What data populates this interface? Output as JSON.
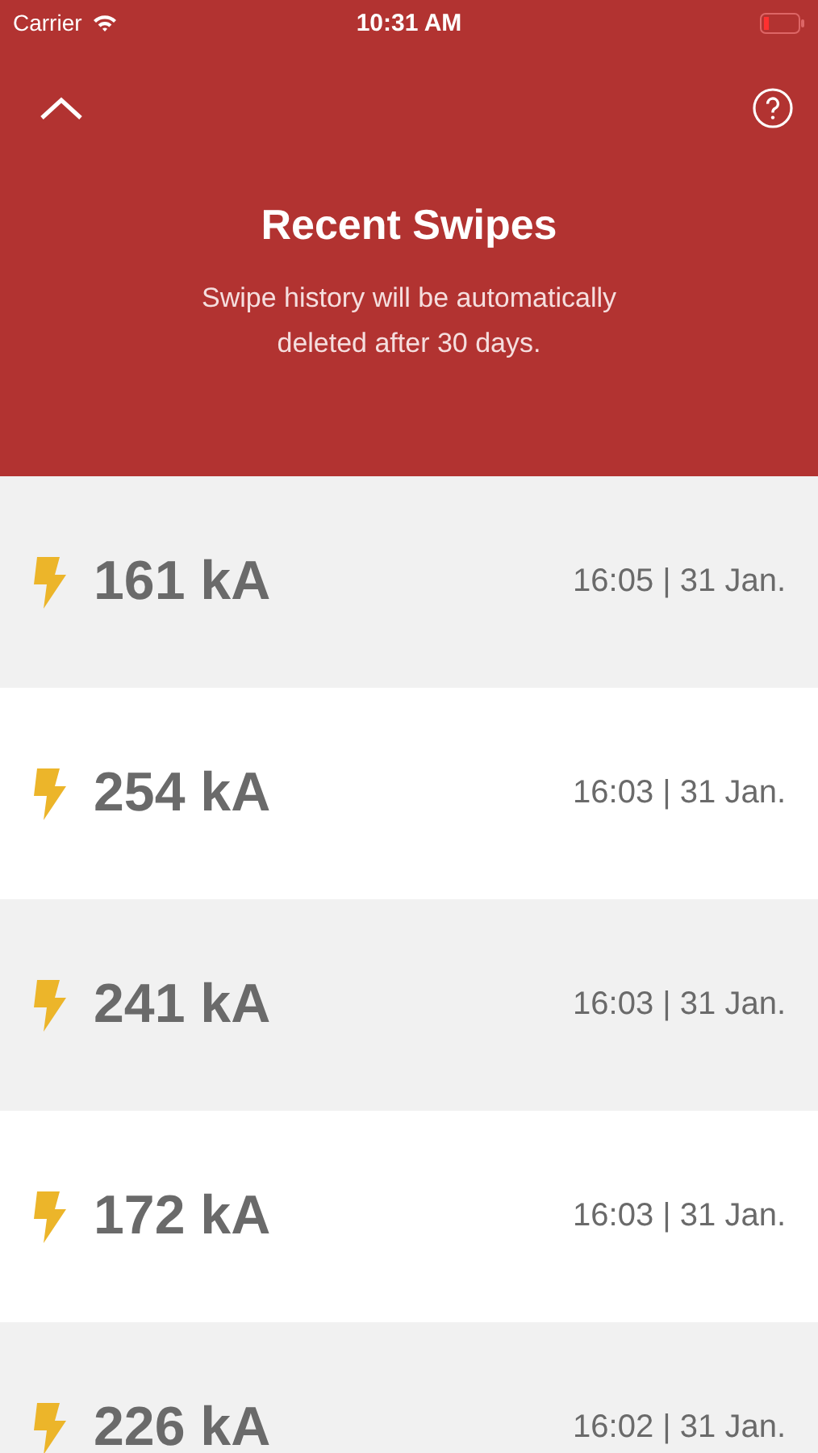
{
  "status_bar": {
    "carrier": "Carrier",
    "time": "10:31 AM"
  },
  "header": {
    "title": "Recent Swipes",
    "subtitle": "Swipe history will be automatically\ndeleted after 30 days."
  },
  "swipes": [
    {
      "current": "161 kA",
      "time": "16:05 | 31 Jan."
    },
    {
      "current": "254 kA",
      "time": "16:03 | 31 Jan."
    },
    {
      "current": "241 kA",
      "time": "16:03 | 31 Jan."
    },
    {
      "current": "172 kA",
      "time": "16:03 | 31 Jan."
    },
    {
      "current": "226 kA",
      "time": "16:02 | 31 Jan."
    }
  ]
}
